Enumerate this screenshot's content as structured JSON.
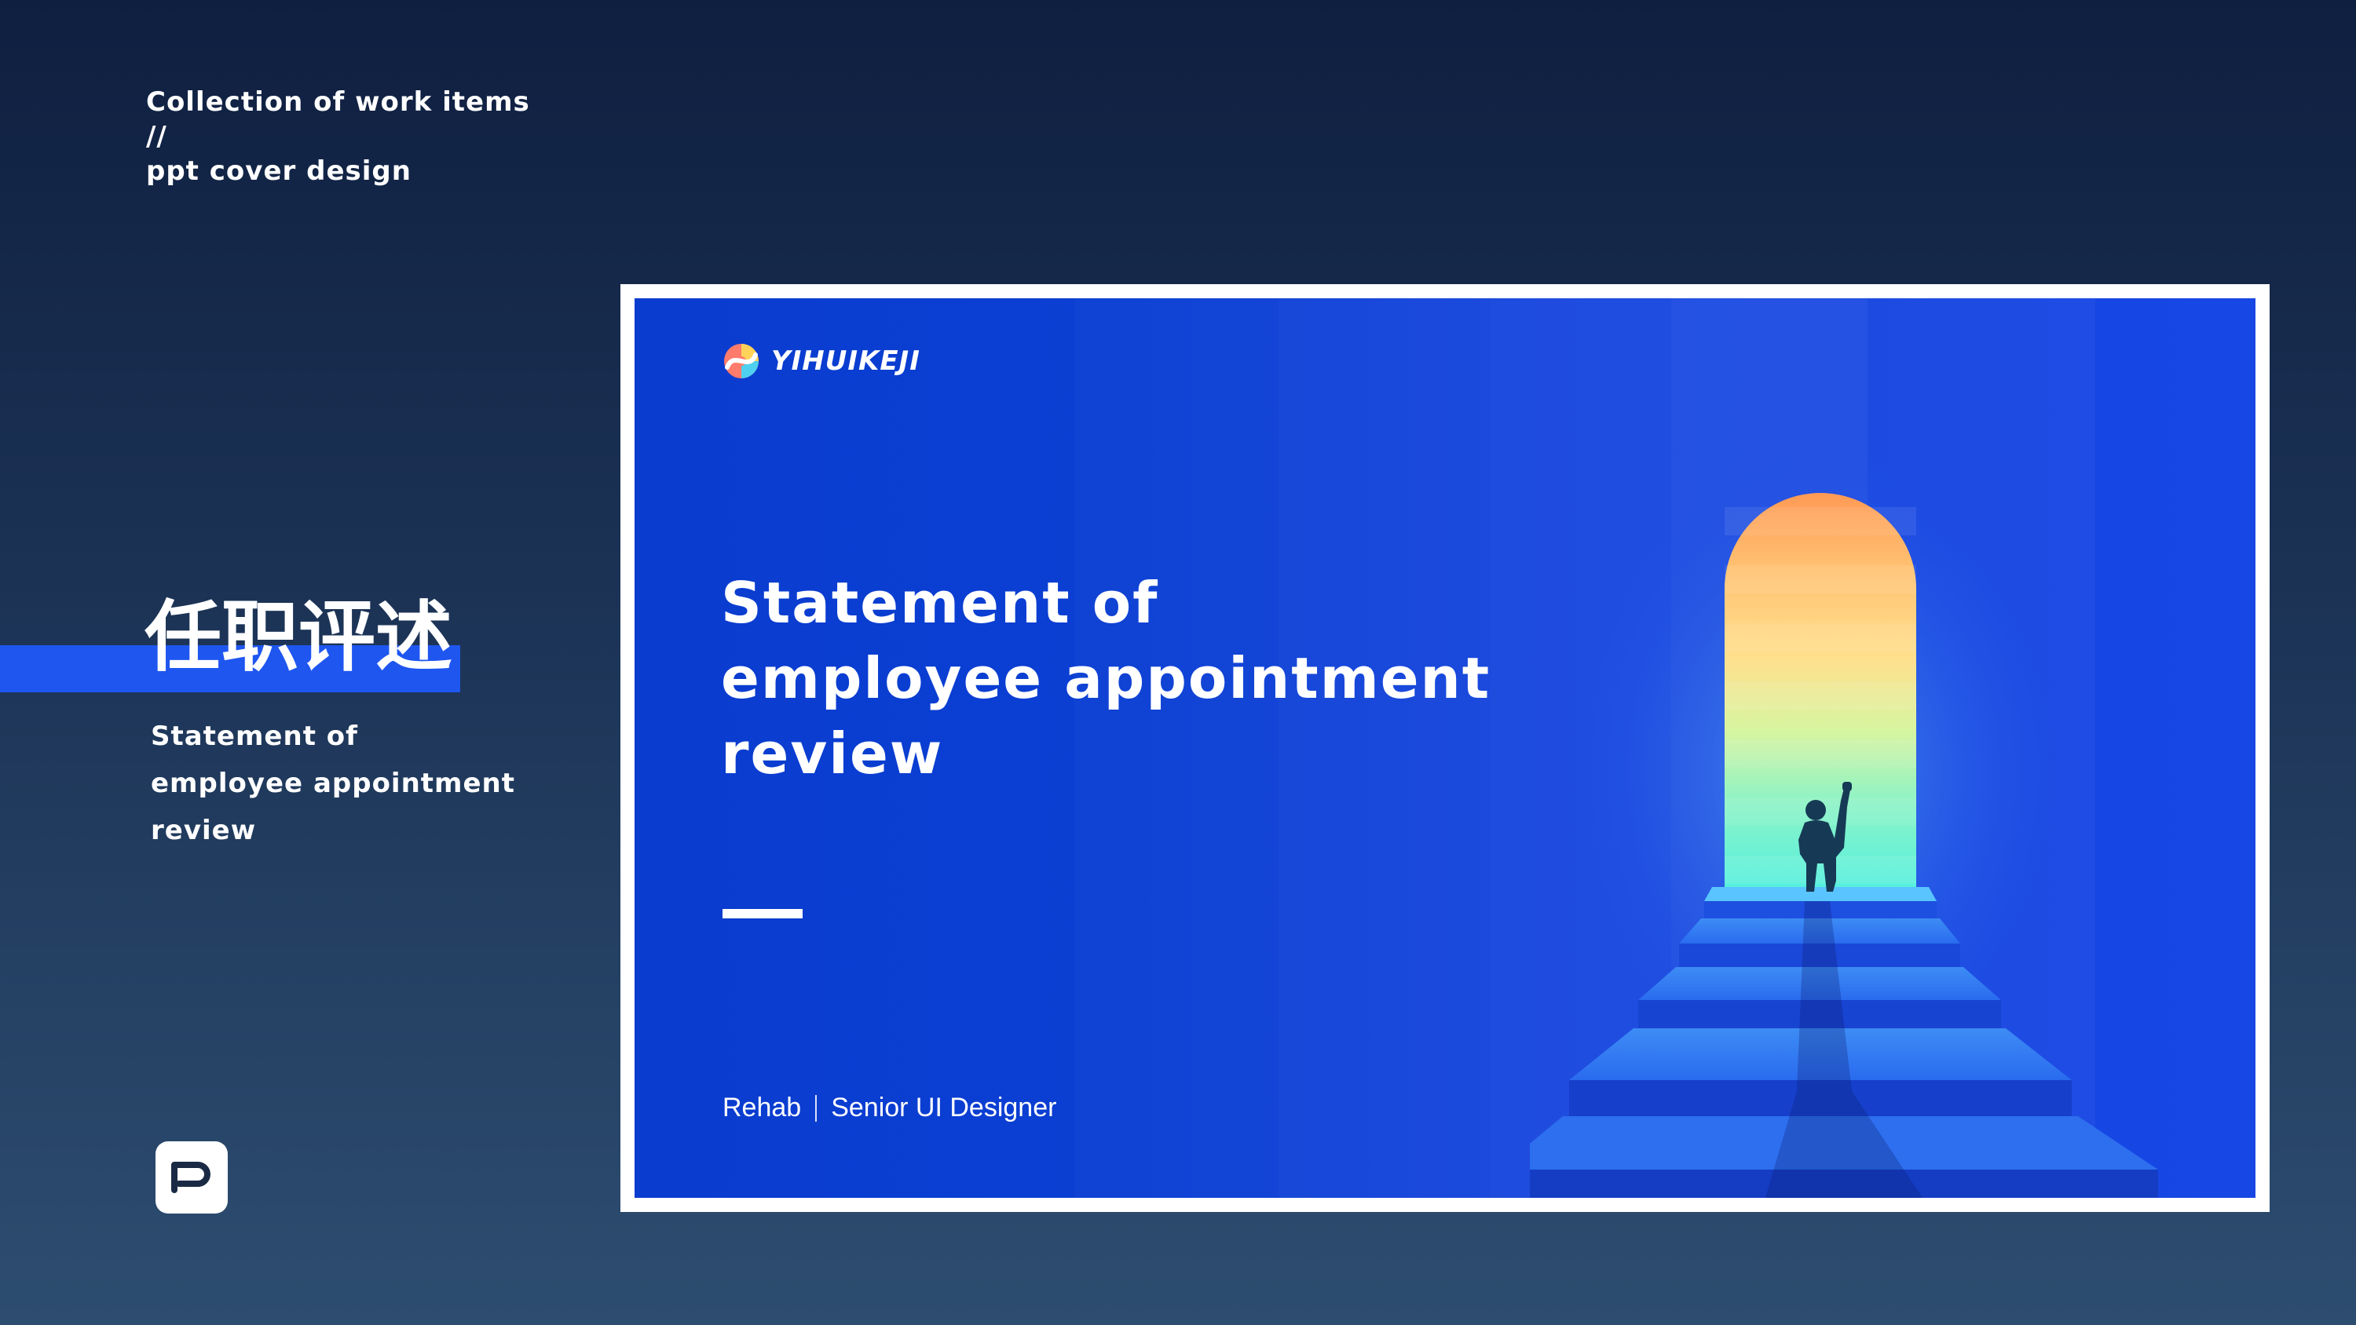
{
  "header": {
    "line1": "Collection of work items",
    "line2": "//",
    "line3": "ppt cover design"
  },
  "section": {
    "cn_title": "任职评述",
    "en_lines": [
      "Statement of",
      "employee appointment",
      "review"
    ]
  },
  "app_icon": {
    "glyph": "P",
    "icon": "p-logo-icon"
  },
  "slide": {
    "brand": "YIHUIKEJI",
    "title_lines": [
      "Statement of",
      "employee appointment",
      "review"
    ],
    "author_name": "Rehab",
    "author_role": "Senior UI Designer"
  },
  "colors": {
    "background_top": "#0f1f40",
    "background_bottom": "#2d4d70",
    "accent_blue": "#1f56f0",
    "slide_blue": "#0b3fd3",
    "door_orange": "#ff9a55",
    "door_mint": "#5ef5d6"
  }
}
